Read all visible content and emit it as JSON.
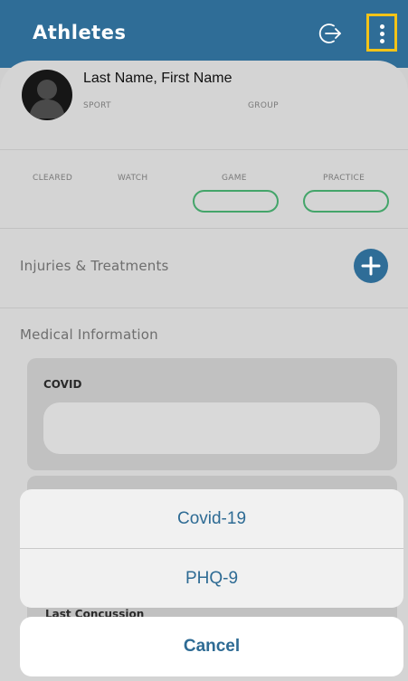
{
  "header": {
    "title": "Athletes",
    "exit_icon": "exit-arrow-icon",
    "menu_icon": "more-vertical-icon"
  },
  "profile": {
    "name": "Last Name, First Name",
    "sport_label": "SPORT",
    "group_label": "GROUP"
  },
  "status": {
    "cleared_label": "CLEARED",
    "watch_label": "WATCH",
    "game_label": "GAME",
    "practice_label": "PRACTICE"
  },
  "injuries": {
    "title": "Injuries & Treatments",
    "add_icon": "plus-icon"
  },
  "medical": {
    "title": "Medical Information",
    "covid_label": "COVID",
    "last_concussion_label": "Last Concussion"
  },
  "action_sheet": {
    "items": [
      "Covid-19",
      "PHQ-9"
    ],
    "cancel_label": "Cancel"
  },
  "colors": {
    "header": "#2f6d97",
    "highlight": "#f2c318",
    "toggle_border": "#44a56a",
    "action_text": "#2e6b94"
  }
}
